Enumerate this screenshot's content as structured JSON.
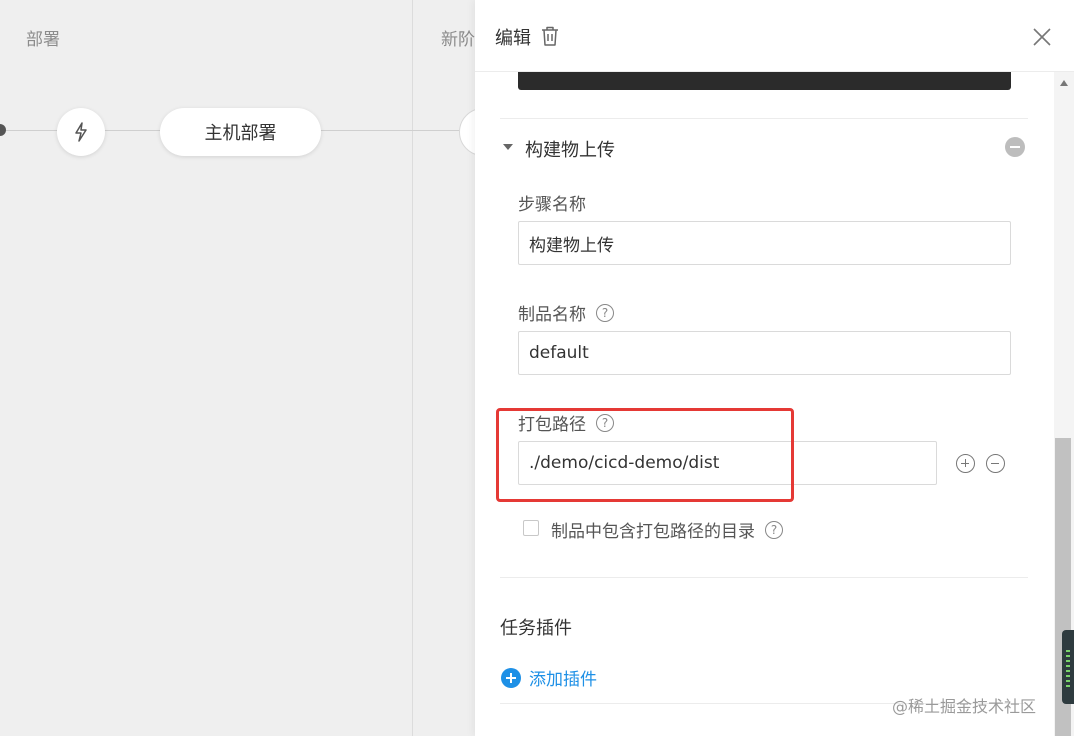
{
  "pipeline": {
    "stage1_title": "部署",
    "stage2_title": "新阶",
    "job_node_label": "主机部署",
    "trigger_icon": "lightning-icon"
  },
  "drawer": {
    "title": "编辑",
    "delete_icon": "trash-icon",
    "close_icon": "close-icon",
    "step": {
      "title": "构建物上传",
      "fields": {
        "step_name_label": "步骤名称",
        "step_name_value": "构建物上传",
        "artifact_name_label": "制品名称",
        "artifact_name_value": "default",
        "package_path_label": "打包路径",
        "package_path_value": "./demo/cicd-demo/dist",
        "include_dir_label": "制品中包含打包路径的目录",
        "include_dir_checked": false
      }
    },
    "plugins": {
      "section_title": "任务插件",
      "add_label": "添加插件"
    }
  },
  "watermark": "@稀土掘金技术社区",
  "colors": {
    "accent": "#1e90e6",
    "highlight_box": "#e53935"
  }
}
